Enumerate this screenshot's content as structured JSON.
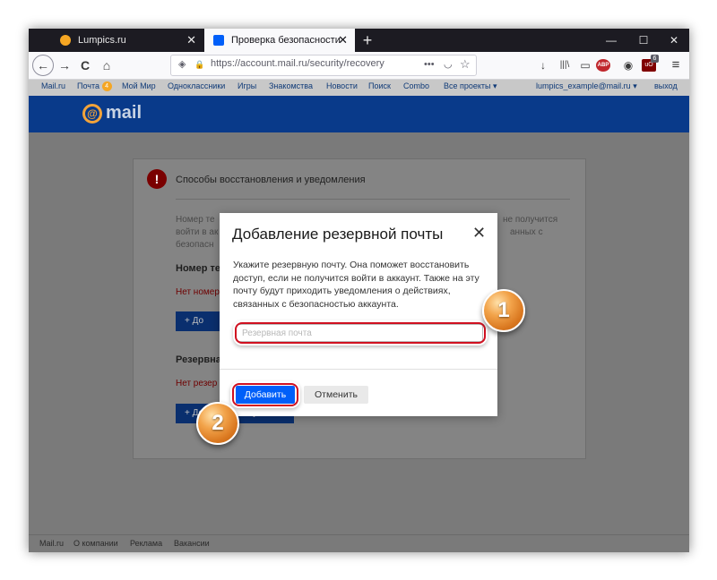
{
  "browser": {
    "tabs": [
      {
        "title": "Lumpics.ru",
        "close": "✕"
      },
      {
        "title": "Проверка безопасности",
        "close": "✕"
      }
    ],
    "new_tab": "+",
    "window_controls": {
      "minimize": "—",
      "maximize": "☐",
      "close": "✕"
    },
    "nav": {
      "back": "←",
      "forward": "→",
      "reload": "C",
      "home": "⌂"
    },
    "url": "https://account.mail.ru/security/recovery",
    "url_icons": {
      "shield": "◈",
      "lock": "🔒",
      "more": "•••",
      "pocket": "◡",
      "star": "☆"
    },
    "toolbar": {
      "download": "↓",
      "library": "|||\\",
      "reader": "▭",
      "abp": "ABP",
      "account": "◉",
      "extension": "uO",
      "extension_badge": "6",
      "menu": "≡"
    }
  },
  "portal_nav": {
    "links": [
      "Mail.ru",
      "Почта",
      "Мой Мир",
      "Одноклассники",
      "Игры",
      "Знакомства",
      "Новости",
      "Поиск",
      "Combo",
      "Все проекты"
    ],
    "mail_count": "4",
    "dropdown_arrow": "▾",
    "user": "lumpics_example@mail.ru",
    "logout": "выход"
  },
  "header": {
    "logo_at": "@",
    "logo_text": "mail"
  },
  "card": {
    "icon": "!",
    "title": "Способы восстановления и уведомления",
    "left_line1": "Номер те",
    "left_line2": "войти в ак",
    "left_line3": "безопасн",
    "right_line1": "не получится",
    "right_line2": "анных с",
    "phone_heading": "Номер те",
    "phone_missing": "Нет номер",
    "phone_button": "+ До",
    "email_heading": "Резервна",
    "email_missing": "Нет резер",
    "email_button": "+ Добавить почту"
  },
  "footer": {
    "links": [
      "Mail.ru",
      "О компании",
      "Реклама",
      "Вакансии"
    ]
  },
  "modal": {
    "title": "Добавление резервной почты",
    "close": "✕",
    "description": "Укажите резервную почту. Она поможет восстановить доступ, если не получится войти в аккаунт. Также на эту почту будут приходить уведомления о действиях, связанных с безопасностью аккаунта.",
    "input_placeholder": "Резервная почта",
    "add_button": "Добавить",
    "cancel_button": "Отменить"
  },
  "callouts": {
    "step1": "1",
    "step2": "2"
  },
  "colors": {
    "accent": "#005ff9",
    "header_blue": "#093a8a",
    "callout_orange": "#e8892c",
    "highlight_red": "#d01020"
  }
}
